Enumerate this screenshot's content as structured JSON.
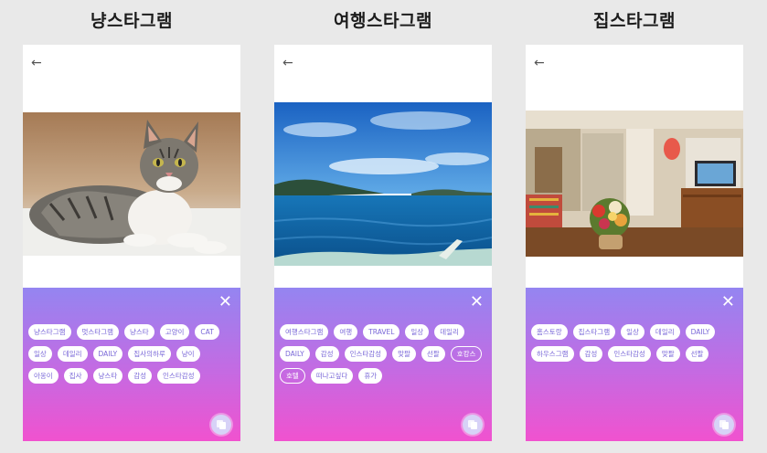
{
  "screens": [
    {
      "title": "냥스타그램",
      "close_icon": "close-icon",
      "tags": [
        {
          "label": "냥스타그램",
          "selected": false
        },
        {
          "label": "멋스타그램",
          "selected": false
        },
        {
          "label": "냥스타",
          "selected": false
        },
        {
          "label": "고양이",
          "selected": false
        },
        {
          "label": "CAT",
          "selected": false
        },
        {
          "label": "일상",
          "selected": false
        },
        {
          "label": "데일리",
          "selected": false
        },
        {
          "label": "DAILY",
          "selected": false
        },
        {
          "label": "집사의하루",
          "selected": false
        },
        {
          "label": "냥이",
          "selected": false
        },
        {
          "label": "아옹이",
          "selected": false
        },
        {
          "label": "집사",
          "selected": false
        },
        {
          "label": "냥스타",
          "selected": false
        },
        {
          "label": "감성",
          "selected": false
        },
        {
          "label": "인스타감성",
          "selected": false
        }
      ]
    },
    {
      "title": "여행스타그램",
      "close_icon": "close-icon",
      "tags": [
        {
          "label": "여행스타그램",
          "selected": false
        },
        {
          "label": "여행",
          "selected": false
        },
        {
          "label": "TRAVEL",
          "selected": false
        },
        {
          "label": "일상",
          "selected": false
        },
        {
          "label": "데일리",
          "selected": false
        },
        {
          "label": "DAILY",
          "selected": false
        },
        {
          "label": "감성",
          "selected": false
        },
        {
          "label": "인스타감성",
          "selected": false
        },
        {
          "label": "맞팔",
          "selected": false
        },
        {
          "label": "선팔",
          "selected": false
        },
        {
          "label": "호캉스",
          "selected": true
        },
        {
          "label": "호텔",
          "selected": true
        },
        {
          "label": "떠나고싶다",
          "selected": false
        },
        {
          "label": "휴가",
          "selected": false
        }
      ]
    },
    {
      "title": "집스타그램",
      "close_icon": "close-icon",
      "tags": [
        {
          "label": "홈스토랑",
          "selected": false
        },
        {
          "label": "집스타그램",
          "selected": false
        },
        {
          "label": "일상",
          "selected": false
        },
        {
          "label": "데일리",
          "selected": false
        },
        {
          "label": "DAILY",
          "selected": false
        },
        {
          "label": "하우스그램",
          "selected": false
        },
        {
          "label": "감성",
          "selected": false
        },
        {
          "label": "인스타감성",
          "selected": false
        },
        {
          "label": "맞팔",
          "selected": false
        },
        {
          "label": "선팔",
          "selected": false
        }
      ]
    }
  ],
  "icons": {
    "back": "back-arrow-icon",
    "copy": "copy-icon"
  },
  "colors": {
    "gradient_top": "#9485f1",
    "gradient_bottom": "#f152cf",
    "tag_text": "#7a68d8"
  }
}
